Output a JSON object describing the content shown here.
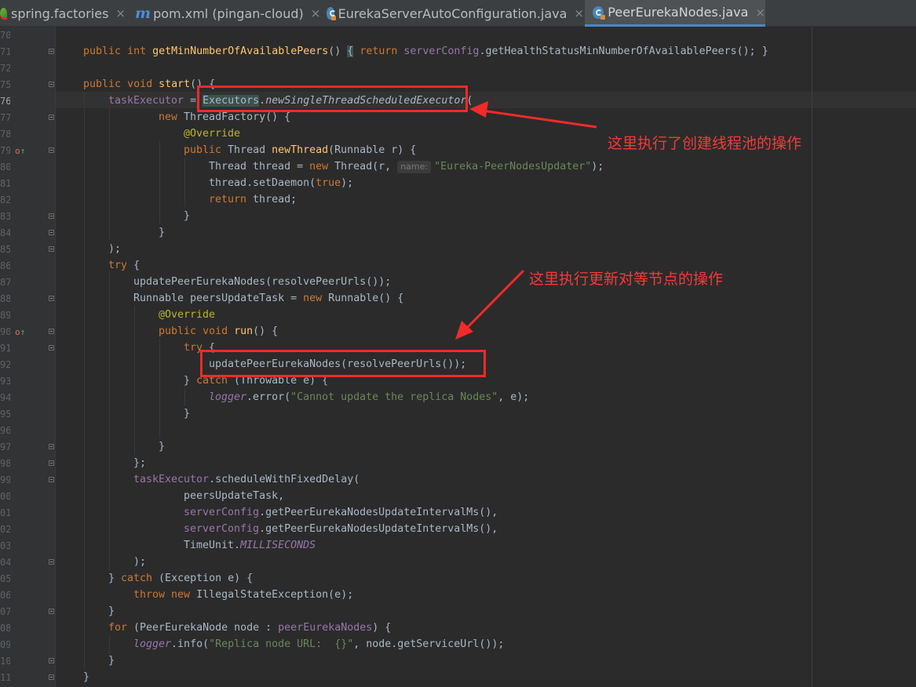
{
  "tabs": [
    {
      "label": "spring.factories",
      "icon": "spring-icon",
      "active": false
    },
    {
      "label": "pom.xml (pingan-cloud)",
      "icon": "maven-icon",
      "active": false
    },
    {
      "label": "EurekaServerAutoConfiguration.java",
      "icon": "java-class-icon",
      "active": false
    },
    {
      "label": "PeerEurekaNodes.java",
      "icon": "java-class-icon",
      "active": true
    }
  ],
  "tab_close_glyph": "×",
  "current_line": "76",
  "line_numbers": [
    "70",
    "71",
    "72",
    "75",
    "76",
    "77",
    "78",
    "79",
    "80",
    "81",
    "82",
    "83",
    "84",
    "85",
    "86",
    "87",
    "88",
    "89",
    "90",
    "91",
    "92",
    "93",
    "94",
    "95",
    "96",
    "97",
    "98",
    "99",
    "00",
    "01",
    "02",
    "03",
    "04",
    "05",
    "06",
    "07",
    "08",
    "09",
    "10",
    "11"
  ],
  "annotations": {
    "top": "这里执行了创建线程池的操作",
    "middle": "这里执行更新对等节点的操作"
  },
  "colors": {
    "keyword": "#cc7832",
    "method": "#ffc66d",
    "field": "#9876aa",
    "string": "#6a8759",
    "annotation": "#bbb529",
    "annotation_box": "#f22a2a"
  },
  "code": {
    "l71": {
      "kw1": "public",
      "kw2": "int",
      "fn": "getMinNumberOfAvailablePeers",
      "p1": "() ",
      "b1": "{",
      "kw3": " return ",
      "fld": "serverConfig",
      "rest": ".getHealthStatusMinNumberOfAvailablePeers();",
      "b2": " }"
    },
    "l75": {
      "kw1": "public",
      "kw2": "void",
      "fn": "start",
      "rest": "() {"
    },
    "l76": {
      "fld": "taskExecutor",
      "eq": " = ",
      "cls": "Executors",
      "dot": ".",
      "meth": "newSingleThreadScheduledExecutor",
      "paren": "("
    },
    "l77": {
      "kw": "new",
      "rest": " ThreadFactory() {"
    },
    "l78": {
      "an": "@Override"
    },
    "l79": {
      "kw": "public",
      "cls": " Thread ",
      "fn": "newThread",
      "rest": "(Runnable r) {"
    },
    "l80": {
      "p1": "Thread thread = ",
      "kw": "new",
      "p2": " Thread(r, ",
      "hint": "name:",
      "str": "\"Eureka-PeerNodesUpdater\"",
      "p3": ");"
    },
    "l81": {
      "p1": "thread.setDaemon(",
      "kw": "true",
      "p2": ");"
    },
    "l82": {
      "kw": "return",
      "rest": " thread;"
    },
    "l83": {
      "rest": "}"
    },
    "l84": {
      "rest": "}"
    },
    "l85": {
      "rest": ");"
    },
    "l86": {
      "kw": "try",
      "rest": " {"
    },
    "l87": {
      "rest": "updatePeerEurekaNodes(resolvePeerUrls());"
    },
    "l88": {
      "p1": "Runnable peersUpdateTask = ",
      "kw": "new",
      "p2": " Runnable() {"
    },
    "l89": {
      "an": "@Override"
    },
    "l90": {
      "kw1": "public",
      "kw2": "void",
      "fn": "run",
      "rest": "() {"
    },
    "l91": {
      "kw": "try",
      "rest": " {"
    },
    "l92": {
      "rest": "updatePeerEurekaNodes(resolvePeerUrls());"
    },
    "l93": {
      "p1": "} ",
      "kw": "catch",
      "p2": " (Throwable e) {"
    },
    "l94": {
      "fld": "logger",
      "p1": ".error(",
      "str": "\"Cannot update the replica Nodes\"",
      "p2": ", e);"
    },
    "l95": {
      "rest": "}"
    },
    "l97": {
      "rest": "}"
    },
    "l98": {
      "rest": "};"
    },
    "l99": {
      "fld": "taskExecutor",
      "rest": ".scheduleWithFixedDelay("
    },
    "l100": {
      "rest": "peersUpdateTask,"
    },
    "l101": {
      "fld": "serverConfig",
      "rest": ".getPeerEurekaNodesUpdateIntervalMs(),"
    },
    "l102": {
      "fld": "serverConfig",
      "rest": ".getPeerEurekaNodesUpdateIntervalMs(),"
    },
    "l103": {
      "p1": "TimeUnit.",
      "fld": "MILLISECONDS"
    },
    "l104": {
      "rest": ");"
    },
    "l105": {
      "p1": "} ",
      "kw": "catch",
      "p2": " (Exception e) {"
    },
    "l106": {
      "kw": "throw new",
      "rest": " IllegalStateException(e);"
    },
    "l107": {
      "rest": "}"
    },
    "l108": {
      "kw": "for",
      "p1": " (PeerEurekaNode node : ",
      "fld": "peerEurekaNodes",
      "p2": ") {"
    },
    "l109": {
      "fld": "logger",
      "p1": ".info(",
      "str": "\"Replica node URL:  {}\"",
      "p2": ", node.getServiceUrl());"
    },
    "l110": {
      "rest": "}"
    },
    "l111": {
      "rest": "}"
    }
  }
}
